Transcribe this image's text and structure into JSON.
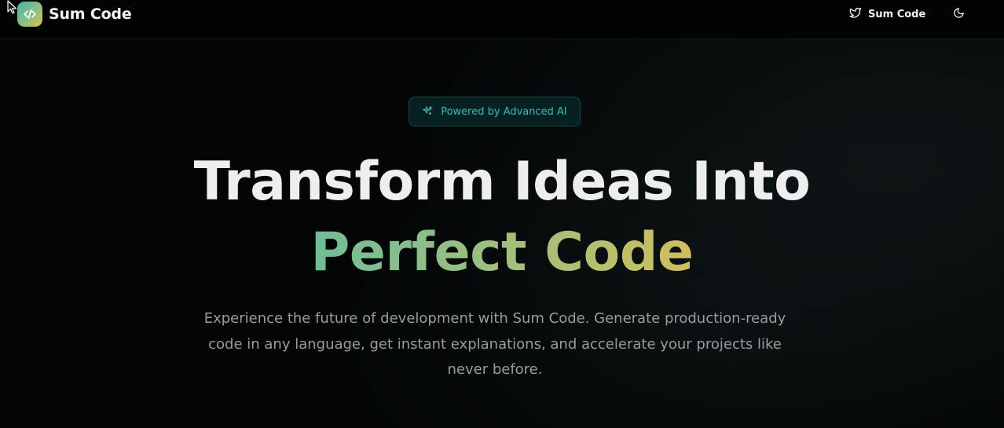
{
  "header": {
    "brand_name": "Sum Code",
    "logo_icon": "code-brackets-icon",
    "twitter_label": "Sum Code",
    "twitter_icon": "twitter-icon",
    "theme_icon": "moon-icon"
  },
  "hero": {
    "badge_label": "Powered by Advanced AI",
    "badge_icon": "sparkles-icon",
    "headline_line1": "Transform Ideas Into",
    "headline_line2": "Perfect Code",
    "description": "Experience the future of development with Sum Code. Generate production-ready code in any language, get instant explanations, and accelerate your projects like never before."
  },
  "colors": {
    "background": "#040606",
    "accent_teal": "#27c0bd",
    "gradient_start": "#6dbd98",
    "gradient_end": "#cfbf5c",
    "logo_gradient_start": "#3fb6a8",
    "logo_gradient_end": "#d8c24a"
  }
}
